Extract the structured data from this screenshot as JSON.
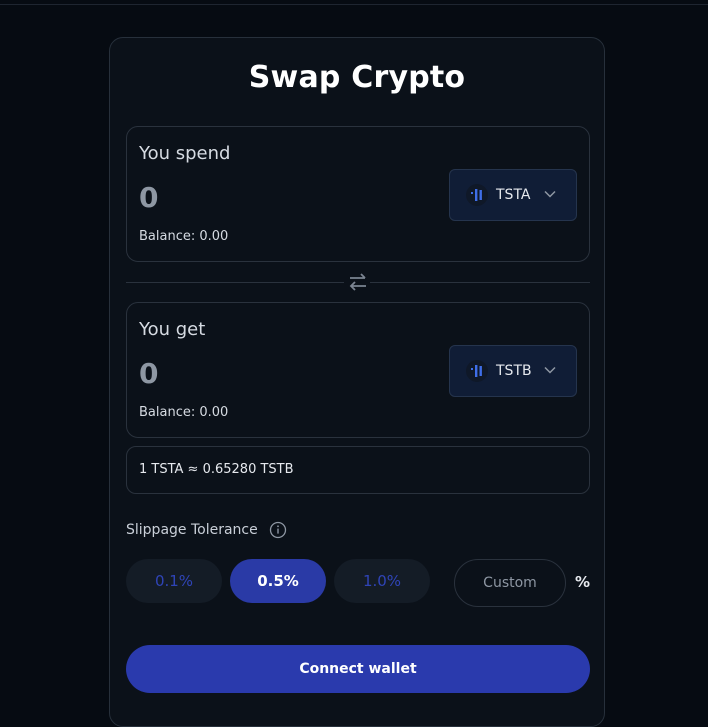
{
  "title": "Swap Crypto",
  "spend": {
    "label": "You spend",
    "amount_placeholder": "0",
    "balance": "Balance: 0.00",
    "token": "TSTA",
    "token_icon": "token-bars-icon"
  },
  "get": {
    "label": "You get",
    "amount_placeholder": "0",
    "balance": "Balance: 0.00",
    "token": "TSTB",
    "token_icon": "token-bars-icon"
  },
  "swap_icon": "swap-arrows-icon",
  "rate": "1 TSTA ≈ 0.65280 TSTB",
  "slippage": {
    "label": "Slippage Tolerance",
    "options": [
      "0.1%",
      "0.5%",
      "1.0%"
    ],
    "selected": "0.5%",
    "custom_placeholder": "Custom",
    "unit": "%"
  },
  "connect_label": "Connect wallet",
  "colors": {
    "background": "#060b12",
    "card": "#0b1119",
    "accent": "#2a3aad",
    "token_select": "#101d36"
  }
}
